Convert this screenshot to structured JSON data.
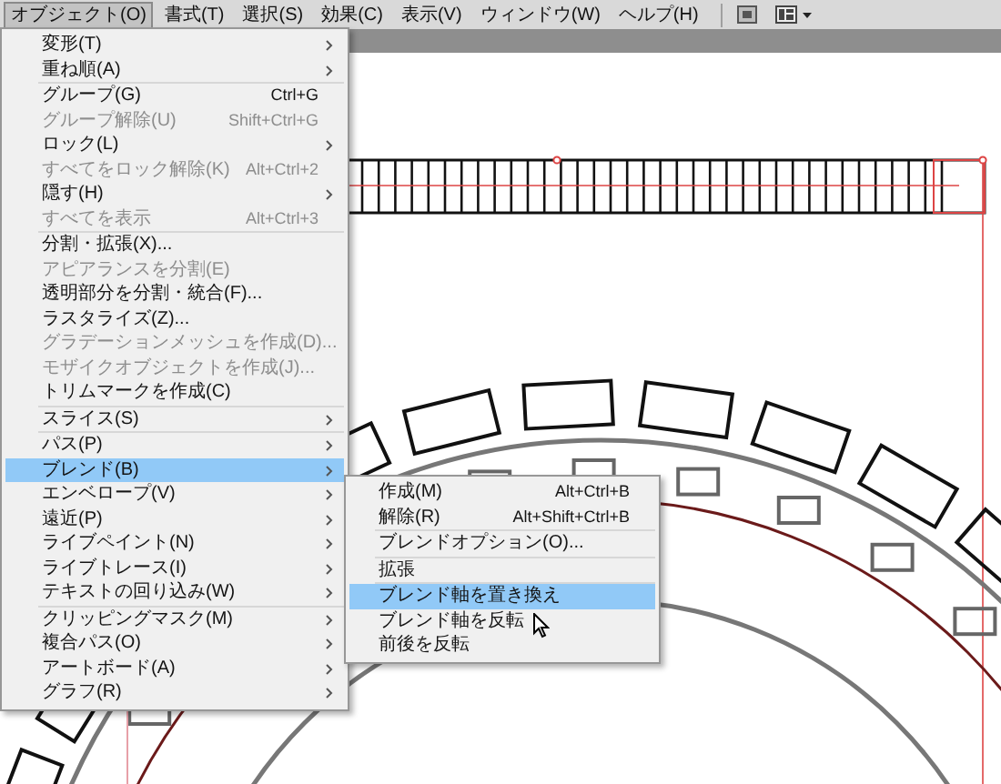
{
  "menubar": [
    {
      "label": "オブジェクト(O)",
      "selected": true
    },
    {
      "label": "書式(T)",
      "selected": false
    },
    {
      "label": "選択(S)",
      "selected": false
    },
    {
      "label": "効果(C)",
      "selected": false
    },
    {
      "label": "表示(V)",
      "selected": false
    },
    {
      "label": "ウィンドウ(W)",
      "selected": false
    },
    {
      "label": "ヘルプ(H)",
      "selected": false
    }
  ],
  "object_menu": [
    {
      "kind": "item",
      "label": "変形(T)",
      "submenu": true,
      "disabled": false,
      "selected": false
    },
    {
      "kind": "item",
      "label": "重ね順(A)",
      "submenu": true,
      "disabled": false,
      "selected": false
    },
    {
      "kind": "separator"
    },
    {
      "kind": "item",
      "label": "グループ(G)",
      "shortcut": "Ctrl+G",
      "disabled": false,
      "selected": false
    },
    {
      "kind": "item",
      "label": "グループ解除(U)",
      "shortcut": "Shift+Ctrl+G",
      "disabled": true,
      "selected": false
    },
    {
      "kind": "item",
      "label": "ロック(L)",
      "submenu": true,
      "disabled": false,
      "selected": false
    },
    {
      "kind": "item",
      "label": "すべてをロック解除(K)",
      "shortcut": "Alt+Ctrl+2",
      "disabled": true,
      "selected": false
    },
    {
      "kind": "item",
      "label": "隠す(H)",
      "submenu": true,
      "disabled": false,
      "selected": false
    },
    {
      "kind": "item",
      "label": "すべてを表示",
      "shortcut": "Alt+Ctrl+3",
      "disabled": true,
      "selected": false
    },
    {
      "kind": "separator"
    },
    {
      "kind": "item",
      "label": "分割・拡張(X)...",
      "disabled": false,
      "selected": false
    },
    {
      "kind": "item",
      "label": "アピアランスを分割(E)",
      "disabled": true,
      "selected": false
    },
    {
      "kind": "item",
      "label": "透明部分を分割・統合(F)...",
      "disabled": false,
      "selected": false
    },
    {
      "kind": "item",
      "label": "ラスタライズ(Z)...",
      "disabled": false,
      "selected": false
    },
    {
      "kind": "item",
      "label": "グラデーションメッシュを作成(D)...",
      "disabled": true,
      "selected": false
    },
    {
      "kind": "item",
      "label": "モザイクオブジェクトを作成(J)...",
      "disabled": true,
      "selected": false
    },
    {
      "kind": "item",
      "label": "トリムマークを作成(C)",
      "disabled": false,
      "selected": false
    },
    {
      "kind": "separator"
    },
    {
      "kind": "item",
      "label": "スライス(S)",
      "submenu": true,
      "disabled": false,
      "selected": false
    },
    {
      "kind": "separator"
    },
    {
      "kind": "item",
      "label": "パス(P)",
      "submenu": true,
      "disabled": false,
      "selected": false
    },
    {
      "kind": "item",
      "label": "ブレンド(B)",
      "submenu": true,
      "disabled": false,
      "selected": true
    },
    {
      "kind": "item",
      "label": "エンベロープ(V)",
      "submenu": true,
      "disabled": false,
      "selected": false
    },
    {
      "kind": "item",
      "label": "遠近(P)",
      "submenu": true,
      "disabled": false,
      "selected": false
    },
    {
      "kind": "item",
      "label": "ライブペイント(N)",
      "submenu": true,
      "disabled": false,
      "selected": false
    },
    {
      "kind": "item",
      "label": "ライブトレース(I)",
      "submenu": true,
      "disabled": false,
      "selected": false
    },
    {
      "kind": "item",
      "label": "テキストの回り込み(W)",
      "submenu": true,
      "disabled": false,
      "selected": false
    },
    {
      "kind": "separator"
    },
    {
      "kind": "item",
      "label": "クリッピングマスク(M)",
      "submenu": true,
      "disabled": false,
      "selected": false
    },
    {
      "kind": "item",
      "label": "複合パス(O)",
      "submenu": true,
      "disabled": false,
      "selected": false
    },
    {
      "kind": "item",
      "label": "アートボード(A)",
      "submenu": true,
      "disabled": false,
      "selected": false
    },
    {
      "kind": "item",
      "label": "グラフ(R)",
      "submenu": true,
      "disabled": false,
      "selected": false
    }
  ],
  "blend_submenu": [
    {
      "kind": "item",
      "label": "作成(M)",
      "shortcut": "Alt+Ctrl+B",
      "selected": false
    },
    {
      "kind": "item",
      "label": "解除(R)",
      "shortcut": "Alt+Shift+Ctrl+B",
      "selected": false
    },
    {
      "kind": "separator"
    },
    {
      "kind": "item",
      "label": "ブレンドオプション(O)...",
      "selected": false
    },
    {
      "kind": "separator"
    },
    {
      "kind": "item",
      "label": "拡張",
      "selected": false
    },
    {
      "kind": "separator"
    },
    {
      "kind": "item",
      "label": "ブレンド軸を置き換え",
      "selected": true
    },
    {
      "kind": "item",
      "label": "ブレンド軸を反転",
      "selected": false
    },
    {
      "kind": "item",
      "label": "前後を反転",
      "selected": false
    }
  ]
}
